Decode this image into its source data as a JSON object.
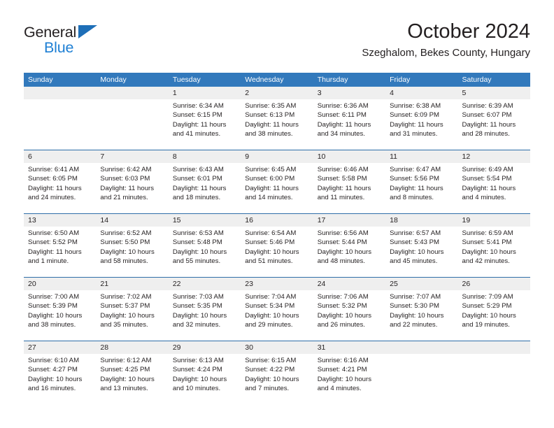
{
  "brand": {
    "name_top": "General",
    "name_bottom": "Blue",
    "accent_color": "#1E7FD4"
  },
  "header": {
    "title": "October 2024",
    "subtitle": "Szeghalom, Bekes County, Hungary"
  },
  "calendar": {
    "header_bg": "#3279BC",
    "header_text_color": "#FFFFFF",
    "row_divider_color": "#2E6DA8",
    "date_band_bg": "#EFEFEF",
    "weekdays": [
      "Sunday",
      "Monday",
      "Tuesday",
      "Wednesday",
      "Thursday",
      "Friday",
      "Saturday"
    ],
    "weeks": [
      [
        {
          "day": "",
          "sunrise": "",
          "sunset": "",
          "daylight": ""
        },
        {
          "day": "",
          "sunrise": "",
          "sunset": "",
          "daylight": ""
        },
        {
          "day": "1",
          "sunrise": "Sunrise: 6:34 AM",
          "sunset": "Sunset: 6:15 PM",
          "daylight": "Daylight: 11 hours and 41 minutes."
        },
        {
          "day": "2",
          "sunrise": "Sunrise: 6:35 AM",
          "sunset": "Sunset: 6:13 PM",
          "daylight": "Daylight: 11 hours and 38 minutes."
        },
        {
          "day": "3",
          "sunrise": "Sunrise: 6:36 AM",
          "sunset": "Sunset: 6:11 PM",
          "daylight": "Daylight: 11 hours and 34 minutes."
        },
        {
          "day": "4",
          "sunrise": "Sunrise: 6:38 AM",
          "sunset": "Sunset: 6:09 PM",
          "daylight": "Daylight: 11 hours and 31 minutes."
        },
        {
          "day": "5",
          "sunrise": "Sunrise: 6:39 AM",
          "sunset": "Sunset: 6:07 PM",
          "daylight": "Daylight: 11 hours and 28 minutes."
        }
      ],
      [
        {
          "day": "6",
          "sunrise": "Sunrise: 6:41 AM",
          "sunset": "Sunset: 6:05 PM",
          "daylight": "Daylight: 11 hours and 24 minutes."
        },
        {
          "day": "7",
          "sunrise": "Sunrise: 6:42 AM",
          "sunset": "Sunset: 6:03 PM",
          "daylight": "Daylight: 11 hours and 21 minutes."
        },
        {
          "day": "8",
          "sunrise": "Sunrise: 6:43 AM",
          "sunset": "Sunset: 6:01 PM",
          "daylight": "Daylight: 11 hours and 18 minutes."
        },
        {
          "day": "9",
          "sunrise": "Sunrise: 6:45 AM",
          "sunset": "Sunset: 6:00 PM",
          "daylight": "Daylight: 11 hours and 14 minutes."
        },
        {
          "day": "10",
          "sunrise": "Sunrise: 6:46 AM",
          "sunset": "Sunset: 5:58 PM",
          "daylight": "Daylight: 11 hours and 11 minutes."
        },
        {
          "day": "11",
          "sunrise": "Sunrise: 6:47 AM",
          "sunset": "Sunset: 5:56 PM",
          "daylight": "Daylight: 11 hours and 8 minutes."
        },
        {
          "day": "12",
          "sunrise": "Sunrise: 6:49 AM",
          "sunset": "Sunset: 5:54 PM",
          "daylight": "Daylight: 11 hours and 4 minutes."
        }
      ],
      [
        {
          "day": "13",
          "sunrise": "Sunrise: 6:50 AM",
          "sunset": "Sunset: 5:52 PM",
          "daylight": "Daylight: 11 hours and 1 minute."
        },
        {
          "day": "14",
          "sunrise": "Sunrise: 6:52 AM",
          "sunset": "Sunset: 5:50 PM",
          "daylight": "Daylight: 10 hours and 58 minutes."
        },
        {
          "day": "15",
          "sunrise": "Sunrise: 6:53 AM",
          "sunset": "Sunset: 5:48 PM",
          "daylight": "Daylight: 10 hours and 55 minutes."
        },
        {
          "day": "16",
          "sunrise": "Sunrise: 6:54 AM",
          "sunset": "Sunset: 5:46 PM",
          "daylight": "Daylight: 10 hours and 51 minutes."
        },
        {
          "day": "17",
          "sunrise": "Sunrise: 6:56 AM",
          "sunset": "Sunset: 5:44 PM",
          "daylight": "Daylight: 10 hours and 48 minutes."
        },
        {
          "day": "18",
          "sunrise": "Sunrise: 6:57 AM",
          "sunset": "Sunset: 5:43 PM",
          "daylight": "Daylight: 10 hours and 45 minutes."
        },
        {
          "day": "19",
          "sunrise": "Sunrise: 6:59 AM",
          "sunset": "Sunset: 5:41 PM",
          "daylight": "Daylight: 10 hours and 42 minutes."
        }
      ],
      [
        {
          "day": "20",
          "sunrise": "Sunrise: 7:00 AM",
          "sunset": "Sunset: 5:39 PM",
          "daylight": "Daylight: 10 hours and 38 minutes."
        },
        {
          "day": "21",
          "sunrise": "Sunrise: 7:02 AM",
          "sunset": "Sunset: 5:37 PM",
          "daylight": "Daylight: 10 hours and 35 minutes."
        },
        {
          "day": "22",
          "sunrise": "Sunrise: 7:03 AM",
          "sunset": "Sunset: 5:35 PM",
          "daylight": "Daylight: 10 hours and 32 minutes."
        },
        {
          "day": "23",
          "sunrise": "Sunrise: 7:04 AM",
          "sunset": "Sunset: 5:34 PM",
          "daylight": "Daylight: 10 hours and 29 minutes."
        },
        {
          "day": "24",
          "sunrise": "Sunrise: 7:06 AM",
          "sunset": "Sunset: 5:32 PM",
          "daylight": "Daylight: 10 hours and 26 minutes."
        },
        {
          "day": "25",
          "sunrise": "Sunrise: 7:07 AM",
          "sunset": "Sunset: 5:30 PM",
          "daylight": "Daylight: 10 hours and 22 minutes."
        },
        {
          "day": "26",
          "sunrise": "Sunrise: 7:09 AM",
          "sunset": "Sunset: 5:29 PM",
          "daylight": "Daylight: 10 hours and 19 minutes."
        }
      ],
      [
        {
          "day": "27",
          "sunrise": "Sunrise: 6:10 AM",
          "sunset": "Sunset: 4:27 PM",
          "daylight": "Daylight: 10 hours and 16 minutes."
        },
        {
          "day": "28",
          "sunrise": "Sunrise: 6:12 AM",
          "sunset": "Sunset: 4:25 PM",
          "daylight": "Daylight: 10 hours and 13 minutes."
        },
        {
          "day": "29",
          "sunrise": "Sunrise: 6:13 AM",
          "sunset": "Sunset: 4:24 PM",
          "daylight": "Daylight: 10 hours and 10 minutes."
        },
        {
          "day": "30",
          "sunrise": "Sunrise: 6:15 AM",
          "sunset": "Sunset: 4:22 PM",
          "daylight": "Daylight: 10 hours and 7 minutes."
        },
        {
          "day": "31",
          "sunrise": "Sunrise: 6:16 AM",
          "sunset": "Sunset: 4:21 PM",
          "daylight": "Daylight: 10 hours and 4 minutes."
        },
        {
          "day": "",
          "sunrise": "",
          "sunset": "",
          "daylight": ""
        },
        {
          "day": "",
          "sunrise": "",
          "sunset": "",
          "daylight": ""
        }
      ]
    ]
  }
}
